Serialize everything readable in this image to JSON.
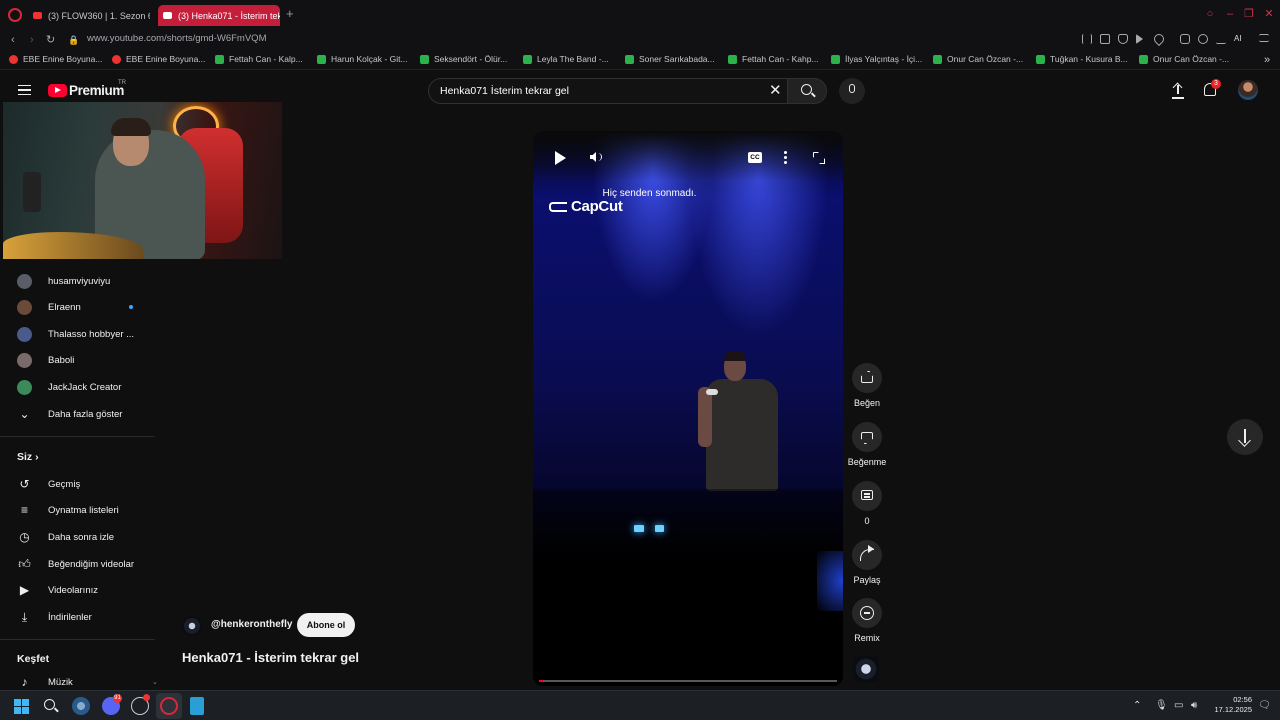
{
  "browser": {
    "tabs": [
      {
        "label": "(3) FLOW360 | 1. Sezon 6",
        "active": false
      },
      {
        "label": "(3) Henka071 - İsterim tek",
        "active": true
      }
    ],
    "url": "www.youtube.com/shorts/gmd-W6FmVQM",
    "bookmarks": [
      {
        "label": "EBE Enine Boyuna...",
        "icon": "youtube-icon"
      },
      {
        "label": "EBE Enine Boyuna...",
        "icon": "youtube-icon"
      },
      {
        "label": "Fettah Can - Kalp...",
        "icon": "sheet-icon"
      },
      {
        "label": "Harun Kolçak - Git...",
        "icon": "sheet-icon"
      },
      {
        "label": "Seksendört - Ölür...",
        "icon": "sheet-icon"
      },
      {
        "label": "Leyla The Band -...",
        "icon": "sheet-icon"
      },
      {
        "label": "Soner Sarıkabada...",
        "icon": "sheet-icon"
      },
      {
        "label": "Fettah Can - Kahp...",
        "icon": "sheet-icon"
      },
      {
        "label": "İlyas Yalçıntaş - İçi...",
        "icon": "sheet-icon"
      },
      {
        "label": "Onur Can Özcan -...",
        "icon": "sheet-icon"
      },
      {
        "label": "Tuğkan - Kusura B...",
        "icon": "sheet-icon"
      },
      {
        "label": "Onur Can Özcan -...",
        "icon": "sheet-icon"
      }
    ],
    "toolbar_ai_label": "AI"
  },
  "header": {
    "logo_text": "Premium",
    "logo_region": "TR",
    "search_query": "Henka071 İsterim tekrar gel",
    "notification_count": "3"
  },
  "sidebar": {
    "subscriptions": [
      {
        "label": "husamviyuviyu",
        "live": false,
        "avatar_color": "#5a5d66"
      },
      {
        "label": "Elraenn",
        "live": true,
        "avatar_color": "#6b4a3a"
      },
      {
        "label": "Thalasso hobbyer ...",
        "live": false,
        "avatar_color": "#4a5a8a"
      },
      {
        "label": "Baboli",
        "live": false,
        "avatar_color": "#7a6a6a"
      },
      {
        "label": "JackJack Creator",
        "live": false,
        "avatar_color": "#3a8a5a"
      }
    ],
    "show_more": "Daha fazla göster",
    "you_section": "Siz",
    "you_items": [
      {
        "label": "Geçmiş",
        "icon": "history-icon"
      },
      {
        "label": "Oynatma listeleri",
        "icon": "playlists-icon"
      },
      {
        "label": "Daha sonra izle",
        "icon": "watch-later-icon"
      },
      {
        "label": "Beğendiğim videolar",
        "icon": "liked-icon"
      },
      {
        "label": "Videolarınız",
        "icon": "your-videos-icon"
      },
      {
        "label": "İndirilenler",
        "icon": "downloads-icon"
      }
    ],
    "explore_section": "Keşfet",
    "explore_items": [
      {
        "label": "Müzik",
        "icon": "music-icon"
      }
    ]
  },
  "player": {
    "lyric": "Hiç senden sonmadı.",
    "watermark": "CapCut",
    "cc_label": "CC",
    "progress": 0.01
  },
  "actions": {
    "like": "Beğen",
    "dislike": "Beğenme",
    "comments": "0",
    "share": "Paylaş",
    "remix": "Remix"
  },
  "video": {
    "channel": "@henkeronthefly",
    "subscribe": "Abone ol",
    "title": "Henka071 - İsterim tekrar gel"
  },
  "taskbar": {
    "discord_badge": "91",
    "clock_time": "02:56",
    "clock_date": "17.12.2025"
  },
  "colors": {
    "accent": "#ff0033",
    "opera": "#c41e3a",
    "live_dot": "#3ea6ff"
  }
}
